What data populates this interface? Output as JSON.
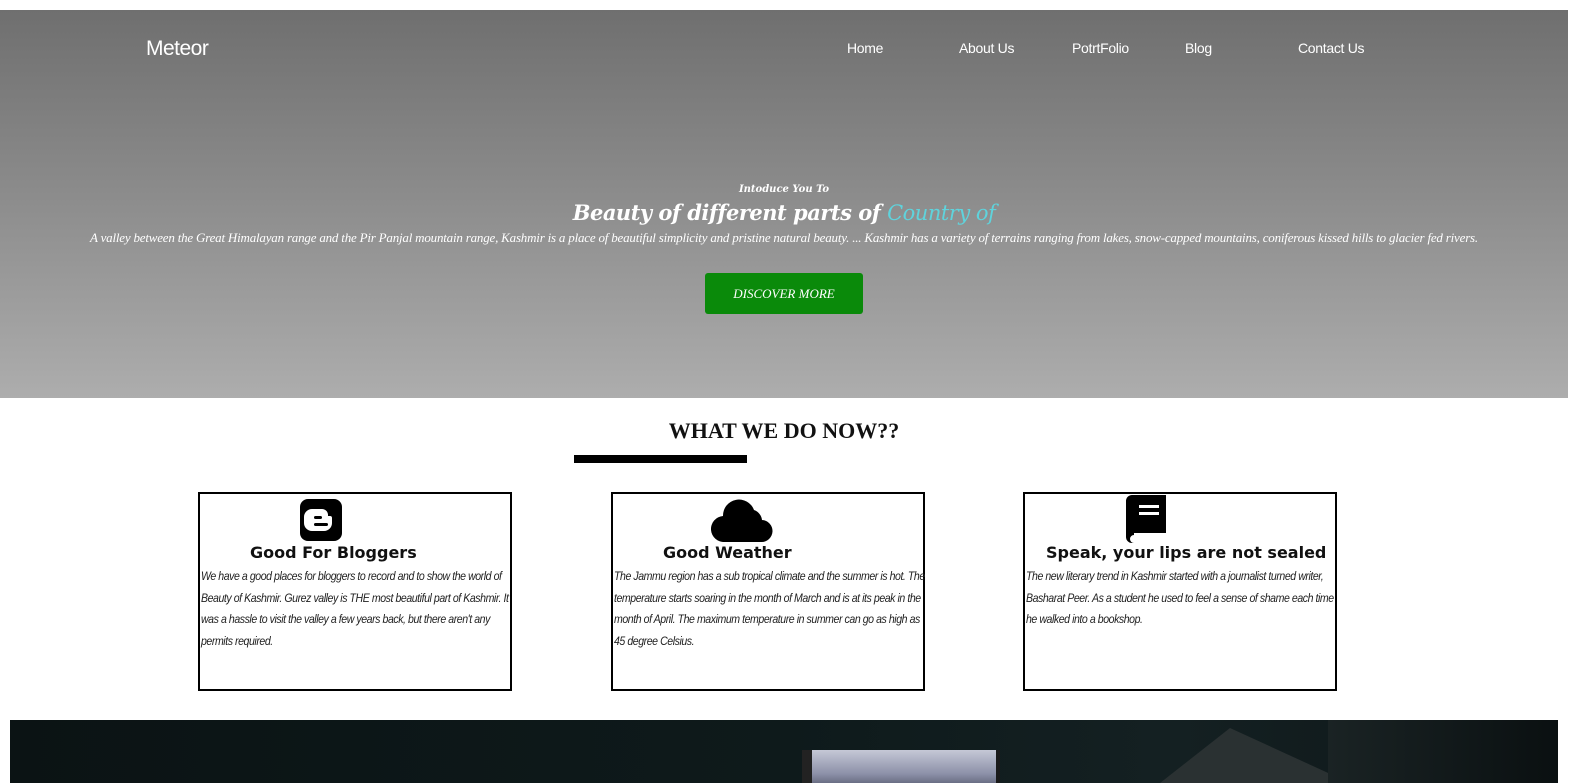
{
  "header": {
    "brand": "Meteor",
    "nav": [
      "Home",
      "About Us",
      "PotrtFolio",
      "Blog",
      "Contact Us"
    ]
  },
  "hero": {
    "intro": "Intoduce You To",
    "title_main": "Beauty of different parts of ",
    "title_accent": "Country of",
    "description": "A valley between the Great Himalayan range and the Pir Panjal mountain range, Kashmir is a place of beautiful simplicity and pristine natural beauty. ... Kashmir has a variety of terrains ranging from lakes, snow-capped mountains, coniferous kissed hills to glacier fed rivers.",
    "button_label": "DISCOVER MORE",
    "accent_color": "#5fd3dc",
    "button_color": "#0a8a0a"
  },
  "section": {
    "title": "WHAT WE DO NOW??",
    "cards": [
      {
        "icon": "blogger-icon",
        "title": "Good For Bloggers",
        "text": "We have a good places for bloggers to record and to show the world of Beauty of Kashmir. Gurez valley is THE most beautiful part of Kashmir. It was a hassle to visit the valley a few years back, but there aren't any permits required."
      },
      {
        "icon": "cloud-icon",
        "title": "Good Weather",
        "text": "The Jammu region has a sub tropical climate and the summer is hot. The temperature starts soaring in the month of March and is at its peak in the month of April. The maximum temperature in summer can go as high as 45 degree Celsius."
      },
      {
        "icon": "book-icon",
        "title": "Speak, your lips are not sealed",
        "text": "The new literary trend in Kashmir started with a journalist turned writer, Basharat Peer. As a student he used to feel a sense of shame each time he walked into a bookshop."
      }
    ]
  }
}
